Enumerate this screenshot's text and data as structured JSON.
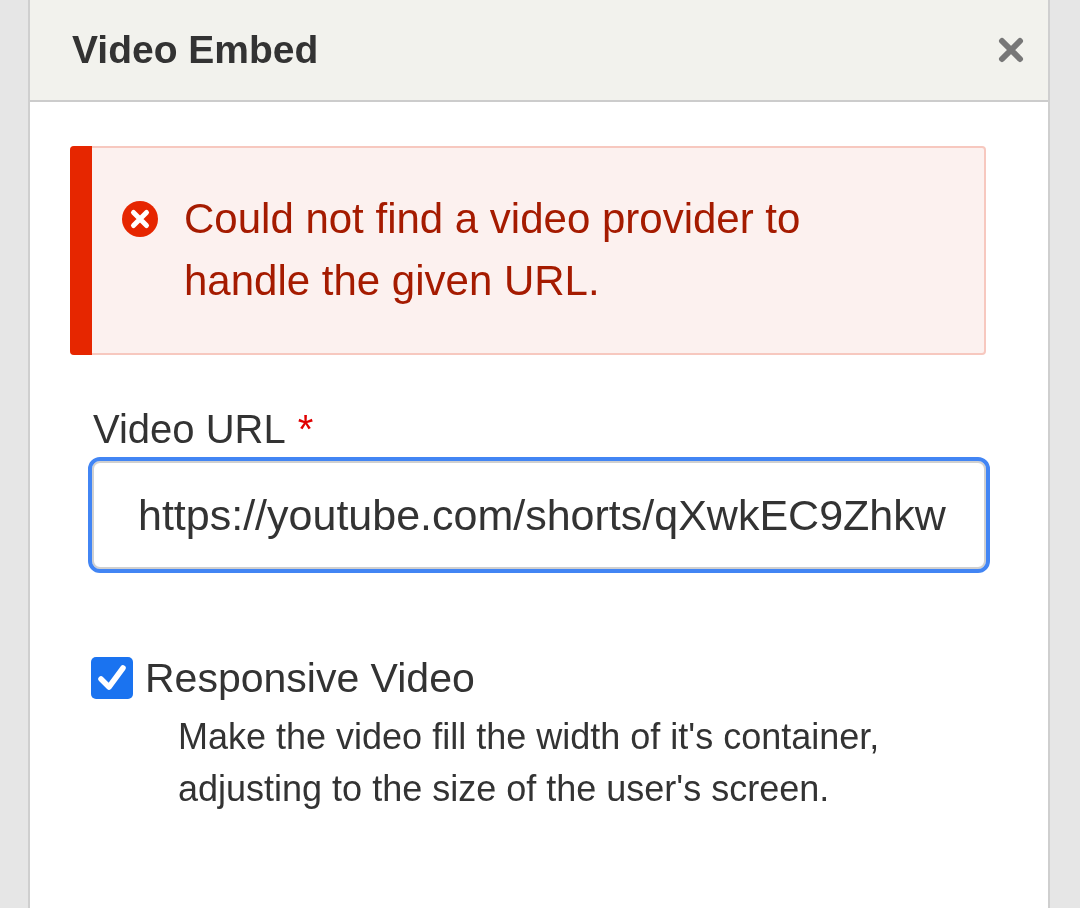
{
  "dialog": {
    "title": "Video Embed"
  },
  "alert": {
    "kind": "error",
    "message": "Could not find a video provider to handle the given URL."
  },
  "fields": [
    {
      "kind": "text",
      "label": "Video URL",
      "required_mark": "*",
      "value": "https://youtube.com/shorts/qXwkEC9Zhkw",
      "focused": true
    },
    {
      "kind": "checkbox",
      "label": "Responsive Video",
      "checked": true,
      "description": "Make the video fill the width of it's container, adjusting to the size of the user's screen."
    }
  ]
}
